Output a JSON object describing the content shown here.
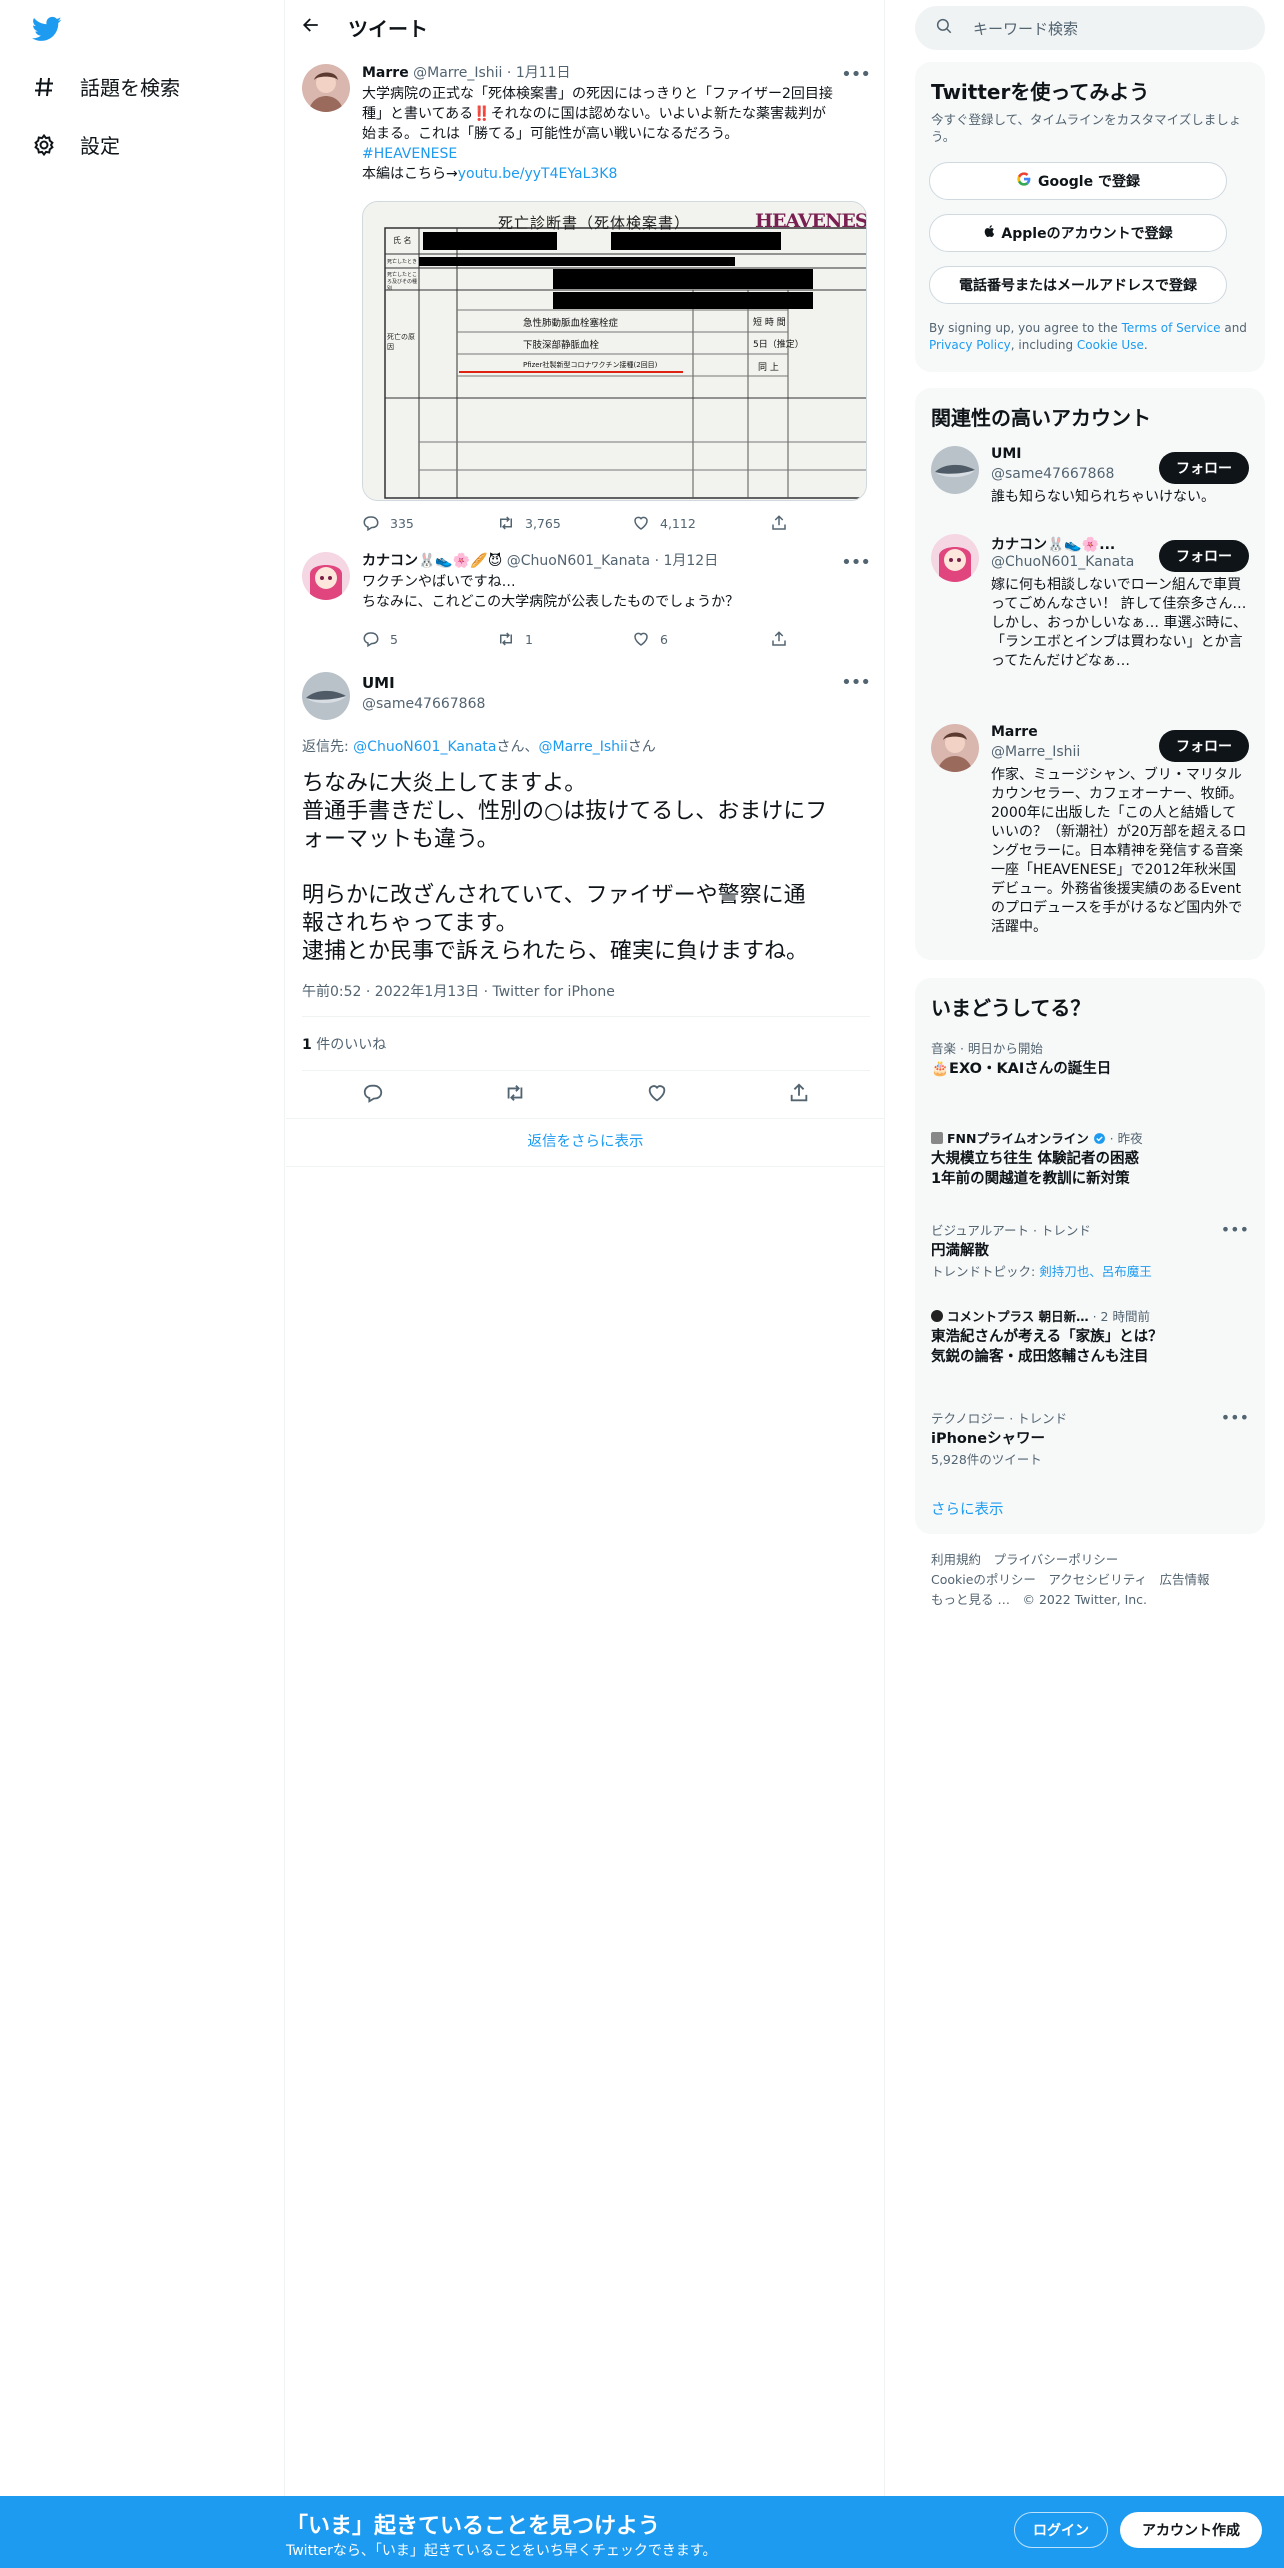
{
  "nav": {
    "explore_label": "話題を検索",
    "settings_label": "設定"
  },
  "header": {
    "title": "ツイート"
  },
  "tweets": [
    {
      "name": "Marre",
      "handle": "@Marre_Ishii",
      "date": "1月11日",
      "text_lines": [
        "大学病院の正式な「死体検案書」の死因にはっきりと「ファイザー2回目接",
        "種」と書いてある‼️それなのに国は認めない。いよいよ新たな薬害裁判が",
        "始まる。これは「勝てる」可能性が高い戦いになるだろう。"
      ],
      "hashtag": "#HEAVENESE",
      "link_prefix": "本編はこちら→",
      "link": "youtu.be/yyT4EYaL3K8",
      "image": {
        "doc_title": "死亡診断書（死体検案書）",
        "brand": "HEAVENESE",
        "row_labels": [
          "氏 名",
          "死亡したとき",
          "死亡したところ及びその種別",
          "死亡の原因"
        ],
        "cause_1": "急性肺動脈血栓塞栓症",
        "cause_2": "下肢深部静脈血栓",
        "cause_3": "Pfizer社製新型コロナワクチン接種(2回目)",
        "interval_1": "短 時 間",
        "interval_2": "5日（推定）",
        "interval_3": "同 上"
      },
      "replies": "335",
      "retweets": "3,765",
      "likes": "4,112"
    },
    {
      "name": "カナコン🐰👟🌸🥖😈",
      "handle": "@ChuoN601_Kanata",
      "date": "1月12日",
      "text_lines": [
        "ワクチンやばいですね…",
        "ちなみに、これどこの大学病院が公表したものでしょうか？"
      ],
      "replies": "5",
      "retweets": "1",
      "likes": "6"
    }
  ],
  "focus": {
    "name": "UMI",
    "handle": "@same47667868",
    "reply_prefix": "返信先: ",
    "reply_to_1": "@ChuoN601_Kanata",
    "reply_sep": "さん、",
    "reply_to_2": "@Marre_Ishii",
    "reply_suffix": "さん",
    "text_lines": [
      "ちなみに大炎上してますよ。",
      "普通手書きだし、性別の○は抜けてるし、おまけにフ",
      "ォーマットも違う。",
      "",
      "明らかに改ざんされていて、ファイザーや警察に通",
      "報されちゃってます。",
      "逮捕とか民事で訴えられたら、確実に負けますね。"
    ],
    "timestamp": "午前0:52 · 2022年1月13日 · Twitter for iPhone",
    "likes_count": "1",
    "likes_label": " 件のいいね",
    "show_more": "返信をさらに表示"
  },
  "right": {
    "search_placeholder": "キーワード検索",
    "signup_card": {
      "title": "Twitterを使ってみよう",
      "subtitle": "今すぐ登録して、タイムラインをカスタマイズしましょう。",
      "google": "Google で登録",
      "apple": "Appleのアカウントで登録",
      "phone": "電話番号またはメールアドレスで登録",
      "legal_1": "By signing up, you agree to the ",
      "terms": "Terms of Service",
      "legal_2": " and ",
      "privacy": "Privacy Policy",
      "legal_3": ", including ",
      "cookie": "Cookie Use",
      "legal_4": "."
    },
    "related": {
      "title": "関連性の高いアカウント",
      "follow_label": "フォロー",
      "accounts": [
        {
          "name": "UMI",
          "handle": "@same47667868",
          "bio": "誰も知らない知られちゃいけない。"
        },
        {
          "name": "カナコン🐰👟🌸...",
          "handle": "@ChuoN601_Kanata",
          "bio": "嫁に何も相談しないでローン組んで車買ってごめんなさい！ 許して佳奈多さん… しかし、おっかしいなぁ… 車選ぶ時に、「ランエボとインプは買わない」とか言ってたんだけどなぁ…"
        },
        {
          "name": "Marre",
          "handle": "@Marre_Ishii",
          "bio": "作家、ミュージシャン、ブリ・マリタルカウンセラー、カフェオーナー、牧師。2000年に出版した「この人と結婚していいの？（新潮社）が20万部を超えるロングセラーに。日本精神を発信する音楽一座「HEAVENESE」で2012年秋米国デビュー。外務省後援実績のあるEventのプロデュースを手がけるなど国内外で活躍中。"
        }
      ]
    },
    "trends": {
      "title": "いまどうしてる？",
      "items": [
        {
          "meta": "音楽 · 明日から開始",
          "title": "🎂EXO・KAIさんの誕生日"
        },
        {
          "source": "FNNプライムオンライン",
          "time": "· 昨夜",
          "title": "大規模立ち往生 体験記者の困惑 1年前の関越道を教訓に新対策"
        },
        {
          "meta": "ビジュアルアート · トレンド",
          "title": "円満解散",
          "topic_prefix": "トレンドトピック: ",
          "topic_links": "剣持刀也、呂布魔王"
        },
        {
          "source": "コメントプラス 朝日新…",
          "time": "· 2 時間前",
          "title": "東浩紀さんが考える「家族」とは？　気鋭の論客・成田悠輔さんも注目"
        },
        {
          "meta": "テクノロジー · トレンド",
          "title": "iPhoneシャワー",
          "count": "5,928件のツイート"
        }
      ],
      "show_more": "さらに表示"
    },
    "footer": {
      "line1": "利用規約　プライバシーポリシー",
      "line2": "Cookieのポリシー　アクセシビリティ　広告情報",
      "line3": "もっと見る …　© 2022 Twitter, Inc."
    }
  },
  "bottom_bar": {
    "title": "「いま」起きていることを見つけよう",
    "subtitle": "Twitterなら、「いま」起きていることをいち早くチェックできます。",
    "login": "ログイン",
    "signup": "アカウント作成"
  },
  "colors": {
    "accent": "#1d9bf0",
    "text": "#0f1419",
    "muted": "#536471",
    "card_bg": "#f7f9f9"
  }
}
